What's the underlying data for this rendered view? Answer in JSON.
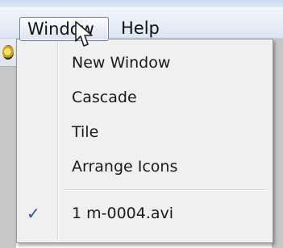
{
  "menubar": {
    "items": [
      {
        "label": "Window"
      },
      {
        "label": "Help"
      }
    ]
  },
  "window_menu": {
    "items": [
      {
        "label": "New Window"
      },
      {
        "label": "Cascade"
      },
      {
        "label": "Tile"
      },
      {
        "label": "Arrange Icons"
      }
    ],
    "recent_files": [
      {
        "label": "1 m-0004.avi",
        "checked": true,
        "check_glyph": "✓"
      }
    ]
  },
  "colors": {
    "menu_background": "#f0f0f0",
    "check_color": "#2f4f8f",
    "menubar_highlight_border": "#6f7f96"
  },
  "icons": {
    "check": "checkmark-icon",
    "cursor": "mouse-pointer-icon",
    "app": "app-icon"
  }
}
